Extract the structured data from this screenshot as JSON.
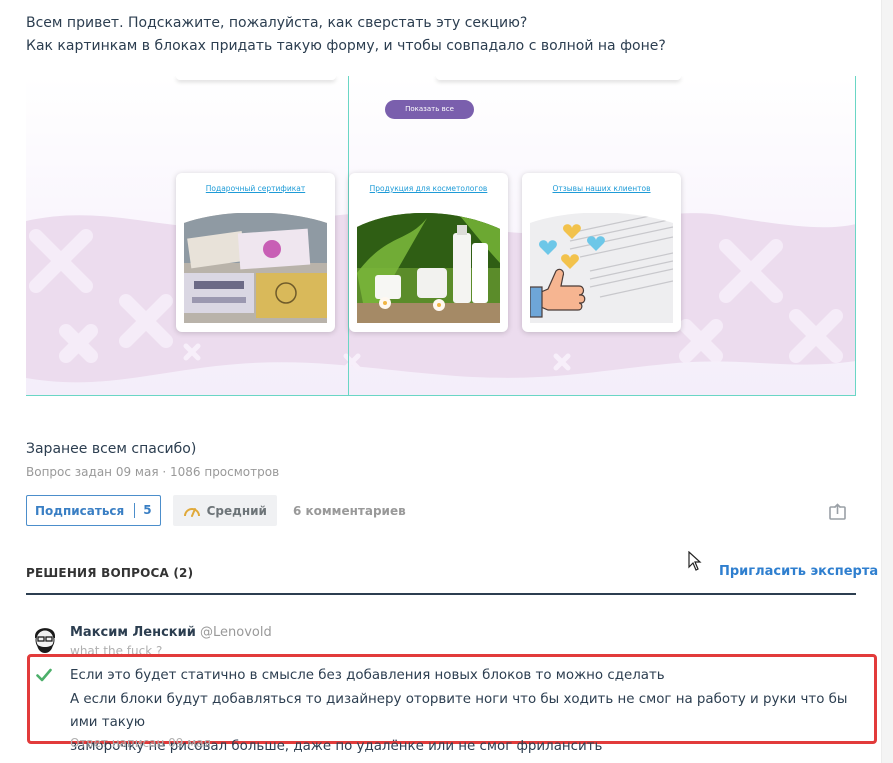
{
  "question": {
    "line1": "Всем привет. Подскажите, пожалуйста, как сверстать эту секцию?",
    "line2": "Как картинкам в блоках придать такую форму, и чтобы совпадало с волной на фоне?",
    "thanks": "Заранее всем спасибо)",
    "meta": "Вопрос задан 09 мая · 1086 просмотров"
  },
  "embedded": {
    "show_all_label": "Показать все",
    "cards": [
      {
        "title": "Подарочный сертификат"
      },
      {
        "title": "Продукция для косметологов"
      },
      {
        "title": "Отзывы наших клиентов"
      }
    ],
    "colors": {
      "button": "#7a5fad",
      "wave": "#ecdcee",
      "link": "#1e9bd7",
      "guide": "#6ad6c5"
    }
  },
  "actions": {
    "subscribe_label": "Подписаться",
    "subscribe_count": "5",
    "level_label": "Средний",
    "comments_label": "6 комментариев",
    "share_icon": "share-icon"
  },
  "solutions": {
    "heading": "РЕШЕНИЯ ВОПРОСА (2)",
    "invite_label": "Пригласить эксперта"
  },
  "answer": {
    "author_name": "Максим Ленский",
    "author_nick": "@Lenovold",
    "author_sub": "what the fuck ?",
    "line1": "Если это будет статично в смысле без добавления новых блоков то можно сделать",
    "line2": "А если блоки будут добавляться то дизайнеру оторвите ноги что бы ходить не смог на работу и руки что бы ими такую",
    "line3": "заморочку не рисовал больше, даже по удалёнке или не смог фрилансить",
    "answered_at": "Ответ написан 09 мая",
    "accent": "#e23b3b",
    "check_color": "#4caf6a"
  }
}
